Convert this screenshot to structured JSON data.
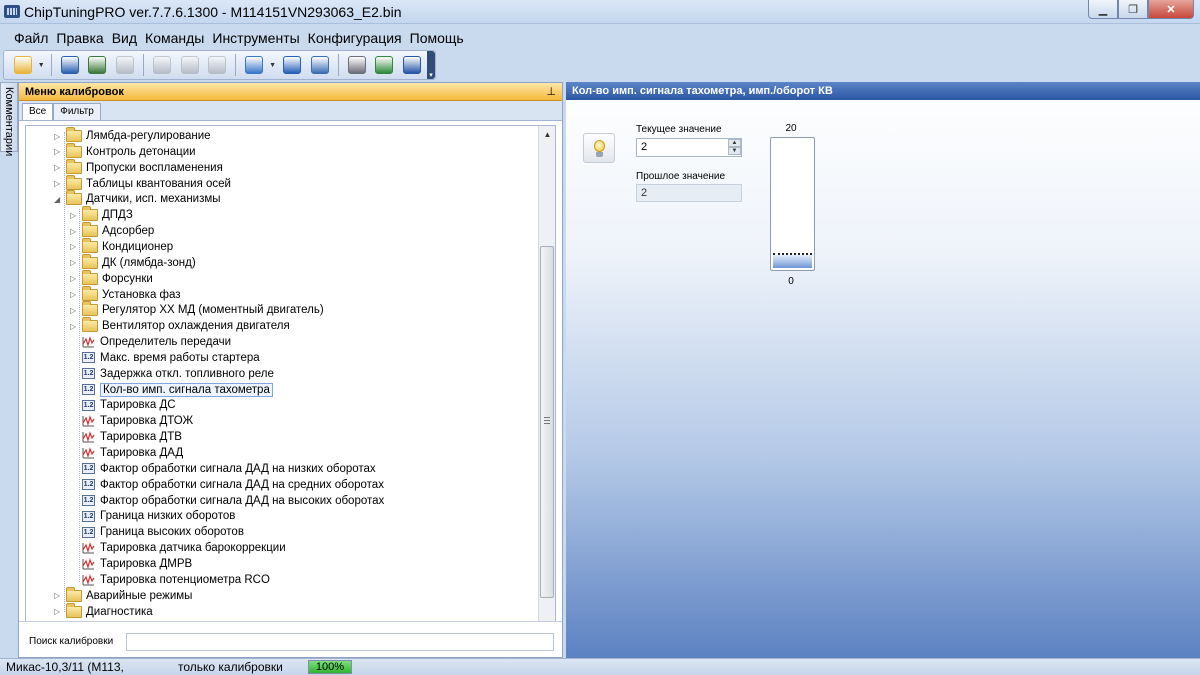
{
  "window": {
    "title": "ChipTuningPRO ver.7.7.6.1300 - M114151VN293063_E2.bin",
    "minimize_glyph": "▁",
    "maximize_glyph": "❐",
    "close_glyph": "✕"
  },
  "menu": [
    "Файл",
    "Правка",
    "Вид",
    "Команды",
    "Инструменты",
    "Конфигурация",
    "Помощь"
  ],
  "toolbar": {
    "buttons": [
      {
        "name": "open-icon",
        "color": "#e8b43a",
        "enabled": true,
        "dropdown": true
      },
      {
        "name": "save-icon",
        "color": "#2a5fb0",
        "enabled": true
      },
      {
        "name": "save-as-icon",
        "color": "#3a7a3a",
        "enabled": true
      },
      {
        "name": "print-icon",
        "color": "#7a7a7a",
        "enabled": false
      },
      {
        "name": "copy-icon",
        "color": "#7a7a7a",
        "enabled": false
      },
      {
        "name": "paste-icon",
        "color": "#7a7a7a",
        "enabled": false
      },
      {
        "name": "undo-icon",
        "color": "#7a7a7a",
        "enabled": false
      },
      {
        "name": "compare-icon",
        "color": "#3a78c8",
        "enabled": true,
        "dropdown": true
      },
      {
        "name": "navigate-icon",
        "color": "#2460b8",
        "enabled": true
      },
      {
        "name": "zoom-icon",
        "color": "#3b6fb5",
        "enabled": true
      },
      {
        "name": "tools-icon",
        "color": "#6b6f77",
        "enabled": true
      },
      {
        "name": "connect-icon",
        "color": "#2f8a3a",
        "enabled": true
      },
      {
        "name": "help-icon",
        "color": "#2455a8",
        "enabled": true
      }
    ]
  },
  "side_tab": "Комментарии",
  "left_panel": {
    "title": "Меню калибровок",
    "pin_glyph": "⊥",
    "tabs": [
      "Все",
      "Фильтр"
    ],
    "search_label": "Поиск калибровки",
    "search_value": "",
    "tree": [
      {
        "label": "Лямбда-регулирование",
        "type": "folder",
        "level": 0,
        "expander": "▷"
      },
      {
        "label": "Контроль детонации",
        "type": "folder",
        "level": 0,
        "expander": "▷"
      },
      {
        "label": "Пропуски воспламенения",
        "type": "folder",
        "level": 0,
        "expander": "▷"
      },
      {
        "label": "Таблицы квантования осей",
        "type": "folder",
        "level": 0,
        "expander": "▷"
      },
      {
        "label": "Датчики, исп. механизмы",
        "type": "folder",
        "level": 0,
        "expander": "◢"
      },
      {
        "label": "ДПДЗ",
        "type": "folder",
        "level": 1,
        "expander": "▷"
      },
      {
        "label": "Адсорбер",
        "type": "folder",
        "level": 1,
        "expander": "▷"
      },
      {
        "label": "Кондиционер",
        "type": "folder",
        "level": 1,
        "expander": "▷"
      },
      {
        "label": "ДК (лямбда-зонд)",
        "type": "folder",
        "level": 1,
        "expander": "▷"
      },
      {
        "label": "Форсунки",
        "type": "folder",
        "level": 1,
        "expander": "▷"
      },
      {
        "label": "Установка фаз",
        "type": "folder",
        "level": 1,
        "expander": "▷"
      },
      {
        "label": "Регулятор ХХ МД (моментный двигатель)",
        "type": "folder",
        "level": 1,
        "expander": "▷"
      },
      {
        "label": "Вентилятор охлаждения двигателя",
        "type": "folder",
        "level": 1,
        "expander": "▷"
      },
      {
        "label": "Определитель передачи",
        "type": "graph",
        "level": 1
      },
      {
        "label": "Макс. время работы стартера",
        "type": "scalar",
        "level": 1
      },
      {
        "label": "Задержка откл. топливного реле",
        "type": "scalar",
        "level": 1
      },
      {
        "label": "Кол-во имп. сигнала тахометра",
        "type": "scalar",
        "level": 1,
        "selected": true
      },
      {
        "label": "Тарировка ДС",
        "type": "scalar",
        "level": 1
      },
      {
        "label": "Тарировка ДТОЖ",
        "type": "graph",
        "level": 1
      },
      {
        "label": "Тарировка ДТВ",
        "type": "graph",
        "level": 1
      },
      {
        "label": "Тарировка ДАД",
        "type": "graph",
        "level": 1
      },
      {
        "label": "Фактор обработки сигнала ДАД на низких оборотах",
        "type": "scalar",
        "level": 1
      },
      {
        "label": "Фактор обработки сигнала ДАД на средних оборотах",
        "type": "scalar",
        "level": 1
      },
      {
        "label": "Фактор обработки сигнала ДАД на высоких оборотах",
        "type": "scalar",
        "level": 1
      },
      {
        "label": "Граница низких оборотов",
        "type": "scalar",
        "level": 1
      },
      {
        "label": "Граница высоких оборотов",
        "type": "scalar",
        "level": 1
      },
      {
        "label": "Тарировка датчика барокоррекции",
        "type": "graph",
        "level": 1
      },
      {
        "label": "Тарировка ДМРВ",
        "type": "graph",
        "level": 1
      },
      {
        "label": "Тарировка потенциометра RCO",
        "type": "graph",
        "level": 1
      },
      {
        "label": "Аварийные режимы",
        "type": "folder",
        "level": 0,
        "expander": "▷"
      },
      {
        "label": "Диагностика",
        "type": "folder",
        "level": 0,
        "expander": "▷"
      }
    ],
    "scroll": {
      "up": "▲",
      "down": "▼"
    }
  },
  "right_panel": {
    "title": "Кол-во имп. сигнала тахометра, имп./оборот КВ",
    "current_label": "Текущее значение",
    "current_value": "2",
    "previous_label": "Прошлое значение",
    "previous_value": "2",
    "spin_up": "▲",
    "spin_down": "▼",
    "gauge": {
      "max_label": "20",
      "min_label": "0",
      "max": 20,
      "min": 0,
      "value": 2
    }
  },
  "status": {
    "left": "Микас-10,3/11 (М113,",
    "mode": "только калибровки",
    "progress_label": "100%",
    "progress": 100
  },
  "colors": {
    "header_orange": "#f6b93d",
    "header_blue": "#2b57a3",
    "progress_green": "#2fb52f"
  }
}
